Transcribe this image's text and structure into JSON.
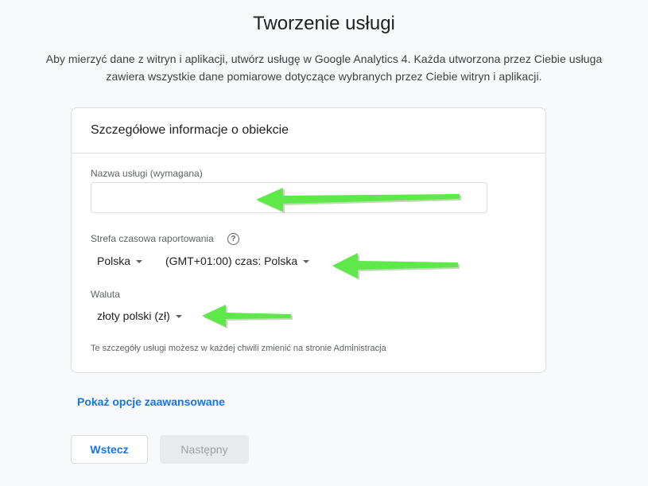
{
  "page": {
    "title": "Tworzenie usługi",
    "subtitle_line1": "Aby mierzyć dane z witryn i aplikacji, utwórz usługę w Google Analytics 4. Każda utworzona przez Ciebie usługa",
    "subtitle_line2": "zawiera wszystkie dane pomiarowe dotyczące wybranych przez Ciebie witryn i aplikacji."
  },
  "card": {
    "title": "Szczegółowe informacje o obiekcie",
    "property_name": {
      "label": "Nazwa usługi (wymagana)",
      "value": ""
    },
    "timezone": {
      "label": "Strefa czasowa raportowania",
      "help_icon": "help-circle-icon",
      "country": "Polska",
      "zone": "(GMT+01:00) czas: Polska"
    },
    "currency": {
      "label": "Waluta",
      "value": "złoty polski (zł)"
    },
    "hint": "Te szczegóły usługi możesz w każdej chwili zmienić na stronie Administracja"
  },
  "advanced_link": "Pokaż opcje zaawansowane",
  "buttons": {
    "back": "Wstecz",
    "next": "Następny"
  },
  "colors": {
    "accent": "#1a73e8",
    "annotation_arrow": "#5fe84a"
  }
}
